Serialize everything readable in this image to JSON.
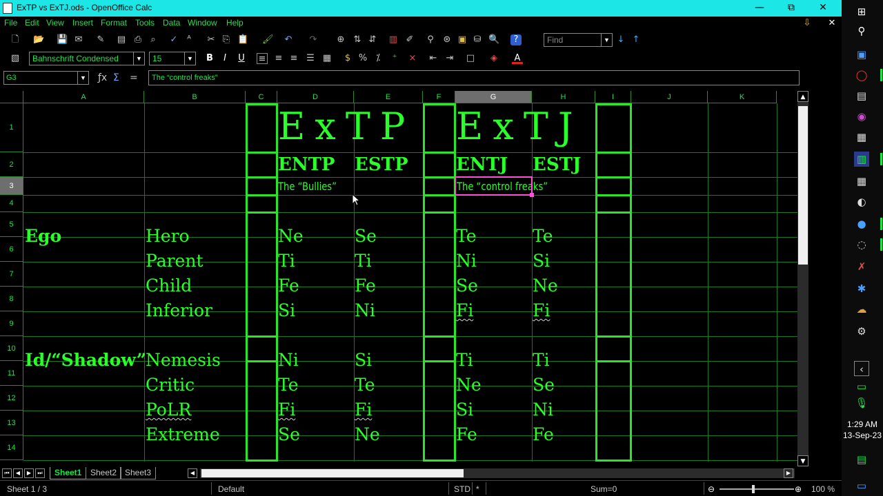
{
  "window": {
    "title": "ExTP vs ExTJ.ods - OpenOffice Calc",
    "minimize": "—",
    "restore": "⧉",
    "close": "✕"
  },
  "menu": [
    "File",
    "Edit",
    "View",
    "Insert",
    "Format",
    "Tools",
    "Data",
    "Window",
    "Help"
  ],
  "toolbar": {
    "find_placeholder": "Find",
    "font_name": "Bahnschrift Condensed",
    "font_size": "15"
  },
  "formula_bar": {
    "cell_ref": "G3",
    "content": "The “control freaks”"
  },
  "columns": [
    "A",
    "B",
    "C",
    "D",
    "E",
    "F",
    "G",
    "H",
    "I",
    "J",
    "K"
  ],
  "rows": [
    "1",
    "2",
    "3",
    "4",
    "5",
    "6",
    "7",
    "8",
    "9",
    "10",
    "11",
    "12",
    "13",
    "14"
  ],
  "cells": {
    "d1": "ExTP",
    "g1": "ExTJ",
    "d2": "ENTP",
    "e2": "ESTP",
    "g2": "ENTJ",
    "h2": "ESTJ",
    "d3": "The “Bullies”",
    "g3": "The “control freaks”",
    "a5": "Ego",
    "a10": "Id/“Shadow”",
    "b5": "Hero",
    "b6": "Parent",
    "b7": "Child",
    "b8": "Inferior",
    "b10": "Nemesis",
    "b11": "Critic",
    "b12": "PoLR",
    "b13": "Extreme",
    "d5": "Ne",
    "e5": "Se",
    "g5": "Te",
    "h5": "Te",
    "d6": "Ti",
    "e6": "Ti",
    "g6": "Ni",
    "h6": "Si",
    "d7": "Fe",
    "e7": "Fe",
    "g7": "Se",
    "h7": "Ne",
    "d8": "Si",
    "e8": "Ni",
    "g8": "Fi",
    "h8": "Fi",
    "d10": "Ni",
    "e10": "Si",
    "g10": "Ti",
    "h10": "Ti",
    "d11": "Te",
    "e11": "Te",
    "g11": "Ne",
    "h11": "Se",
    "d12": "Fi",
    "e12": "Fi",
    "g12": "Si",
    "h12": "Ni",
    "d13": "Se",
    "e13": "Ne",
    "g13": "Fe",
    "h13": "Fe"
  },
  "sheets": [
    "Sheet1",
    "Sheet2",
    "Sheet3"
  ],
  "status": {
    "sheet": "Sheet 1 / 3",
    "style": "Default",
    "mode": "STD",
    "modified": "*",
    "sum": "Sum=0",
    "zoom": "100 %"
  },
  "clock": {
    "time": "1:29 AM",
    "date": "13-Sep-23"
  },
  "colors": {
    "accent": "#29ff29",
    "title_bar": "#1de6e6",
    "selection": "#ff4fd8"
  }
}
